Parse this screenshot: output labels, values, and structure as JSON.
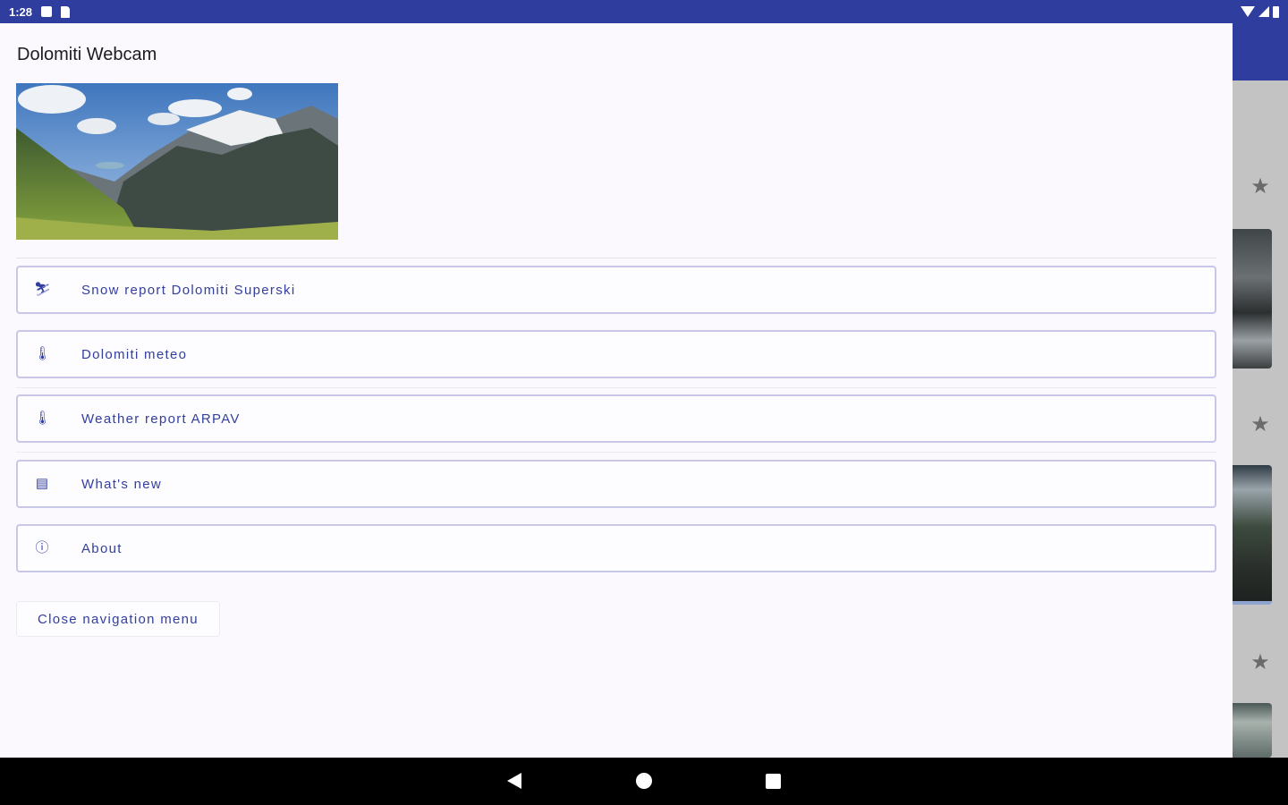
{
  "status_bar": {
    "time": "1:28",
    "icons": [
      "notification-icon",
      "sd-card-icon",
      "wifi-icon",
      "signal-icon",
      "battery-icon"
    ]
  },
  "drawer": {
    "title": "Dolomiti Webcam",
    "header_image": "mountain-panorama",
    "items": [
      {
        "label": "Snow report Dolomiti Superski",
        "icon": "ski-lift-icon"
      },
      {
        "label": "Dolomiti meteo",
        "icon": "thermometer-icon"
      },
      {
        "label": "Weather report ARPAV",
        "icon": "thermometer-icon"
      },
      {
        "label": "What's new",
        "icon": "news-icon"
      },
      {
        "label": "About",
        "icon": "info-icon"
      }
    ],
    "close_label": "Close navigation menu"
  },
  "colors": {
    "primary": "#2f3e9e",
    "accent_text": "#3340a0",
    "drawer_bg": "#fbf9fe",
    "item_border": "#c9c7e8"
  }
}
